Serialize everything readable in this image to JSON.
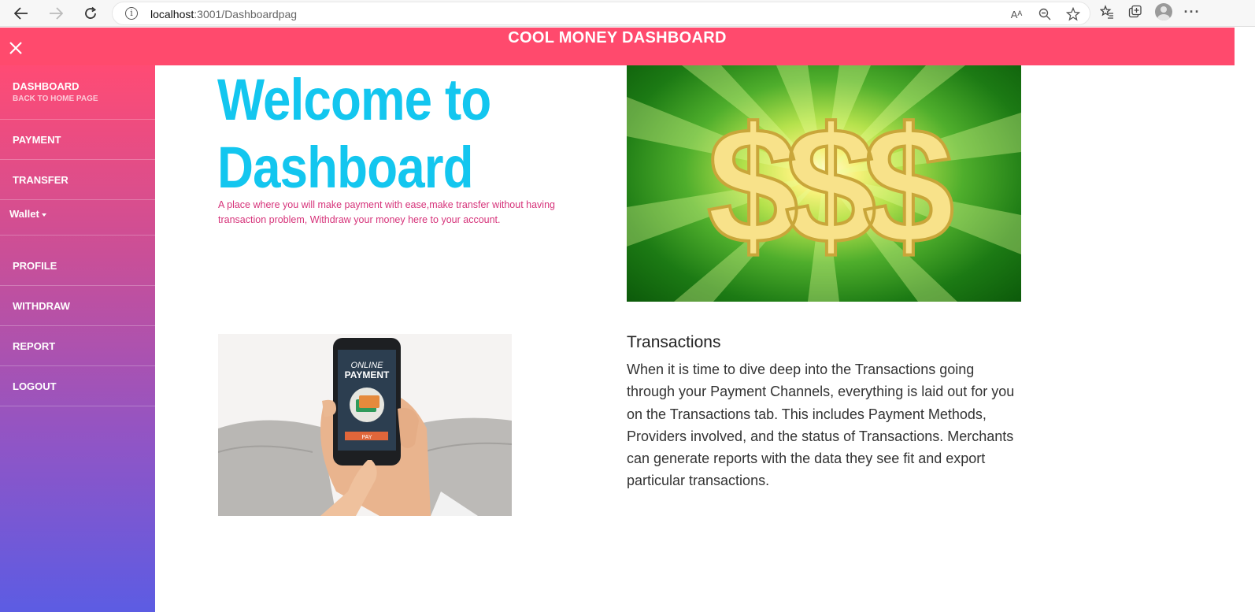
{
  "browser": {
    "url_host": "localhost",
    "url_path": ":3001/Dashboardpag",
    "read_aloud_icon": "Aᴬ"
  },
  "header": {
    "title": "COOL MONEY DASHBOARD"
  },
  "sidebar": {
    "items": [
      {
        "label": "DASHBOARD",
        "sub": "BACK TO HOME PAGE"
      },
      {
        "label": "PAYMENT"
      },
      {
        "label": "TRANSFER"
      },
      {
        "label": "Wallet"
      },
      {
        "label": "PROFILE"
      },
      {
        "label": "WITHDRAW"
      },
      {
        "label": "REPORT"
      },
      {
        "label": "LOGOUT"
      }
    ]
  },
  "main": {
    "welcome_line1": "Welcome to",
    "welcome_line2": "Dashboard",
    "tagline": "A place where you will make payment with ease,make transfer without having transaction problem, Withdraw your money here to your account.",
    "phone_text1": "ONLINE",
    "phone_text2": "PAYMENT",
    "phone_button": "PAY",
    "money_symbols": "$$$",
    "transactions_title": "Transactions",
    "transactions_body": "When it is time to dive deep into the Transactions going through your Payment Channels, everything is laid out for you on the Transactions tab. This includes Payment Methods, Providers involved, and the status of Transactions. Merchants can generate reports with the data they see fit and export particular transactions."
  },
  "colors": {
    "header_bg": "#ff4a6d",
    "welcome_text": "#13c6ef",
    "tagline_text": "#d6337a"
  }
}
